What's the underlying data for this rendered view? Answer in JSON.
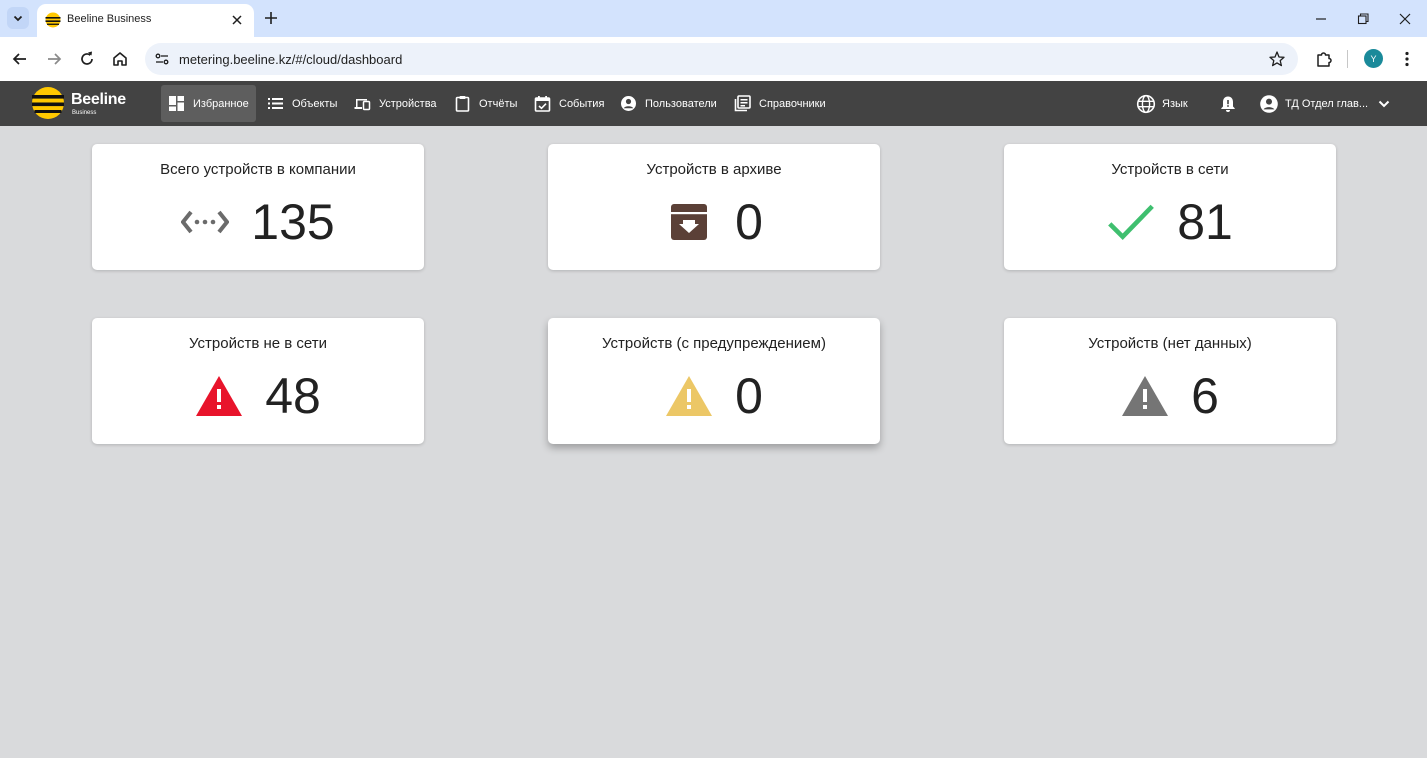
{
  "browser": {
    "tab_title": "Beeline Business",
    "url": "metering.beeline.kz/#/cloud/dashboard",
    "profile_initial": "Y"
  },
  "app": {
    "brand": "Beeline",
    "brand_sub": "Business",
    "nav": [
      {
        "label": "Избранное",
        "icon": "dashboard-icon",
        "active": true
      },
      {
        "label": "Объекты",
        "icon": "list-icon"
      },
      {
        "label": "Устройства",
        "icon": "devices-icon"
      },
      {
        "label": "Отчёты",
        "icon": "clipboard-icon"
      },
      {
        "label": "События",
        "icon": "calendar-check-icon"
      },
      {
        "label": "Пользователи",
        "icon": "account-circle-icon"
      },
      {
        "label": "Справочники",
        "icon": "library-books-icon"
      }
    ],
    "language_label": "Язык",
    "user_label": "ТД Отдел глав..."
  },
  "cards": [
    {
      "title": "Всего устройств в компании",
      "value": "135",
      "icon": "connection-icon",
      "color": "#6b6b6b"
    },
    {
      "title": "Устройств в архиве",
      "value": "0",
      "icon": "archive-icon",
      "color": "#5b4037"
    },
    {
      "title": "Устройств в сети",
      "value": "81",
      "icon": "checkmark-icon",
      "color": "#3fbf6f"
    },
    {
      "title": "Устройств не в сети",
      "value": "48",
      "icon": "warning-icon",
      "color": "#e8142b"
    },
    {
      "title": "Устройств (с предупреждением)",
      "value": "0",
      "icon": "warning-icon",
      "color": "#ecc766"
    },
    {
      "title": "Устройств (нет данных)",
      "value": "6",
      "icon": "warning-icon",
      "color": "#757575"
    }
  ]
}
